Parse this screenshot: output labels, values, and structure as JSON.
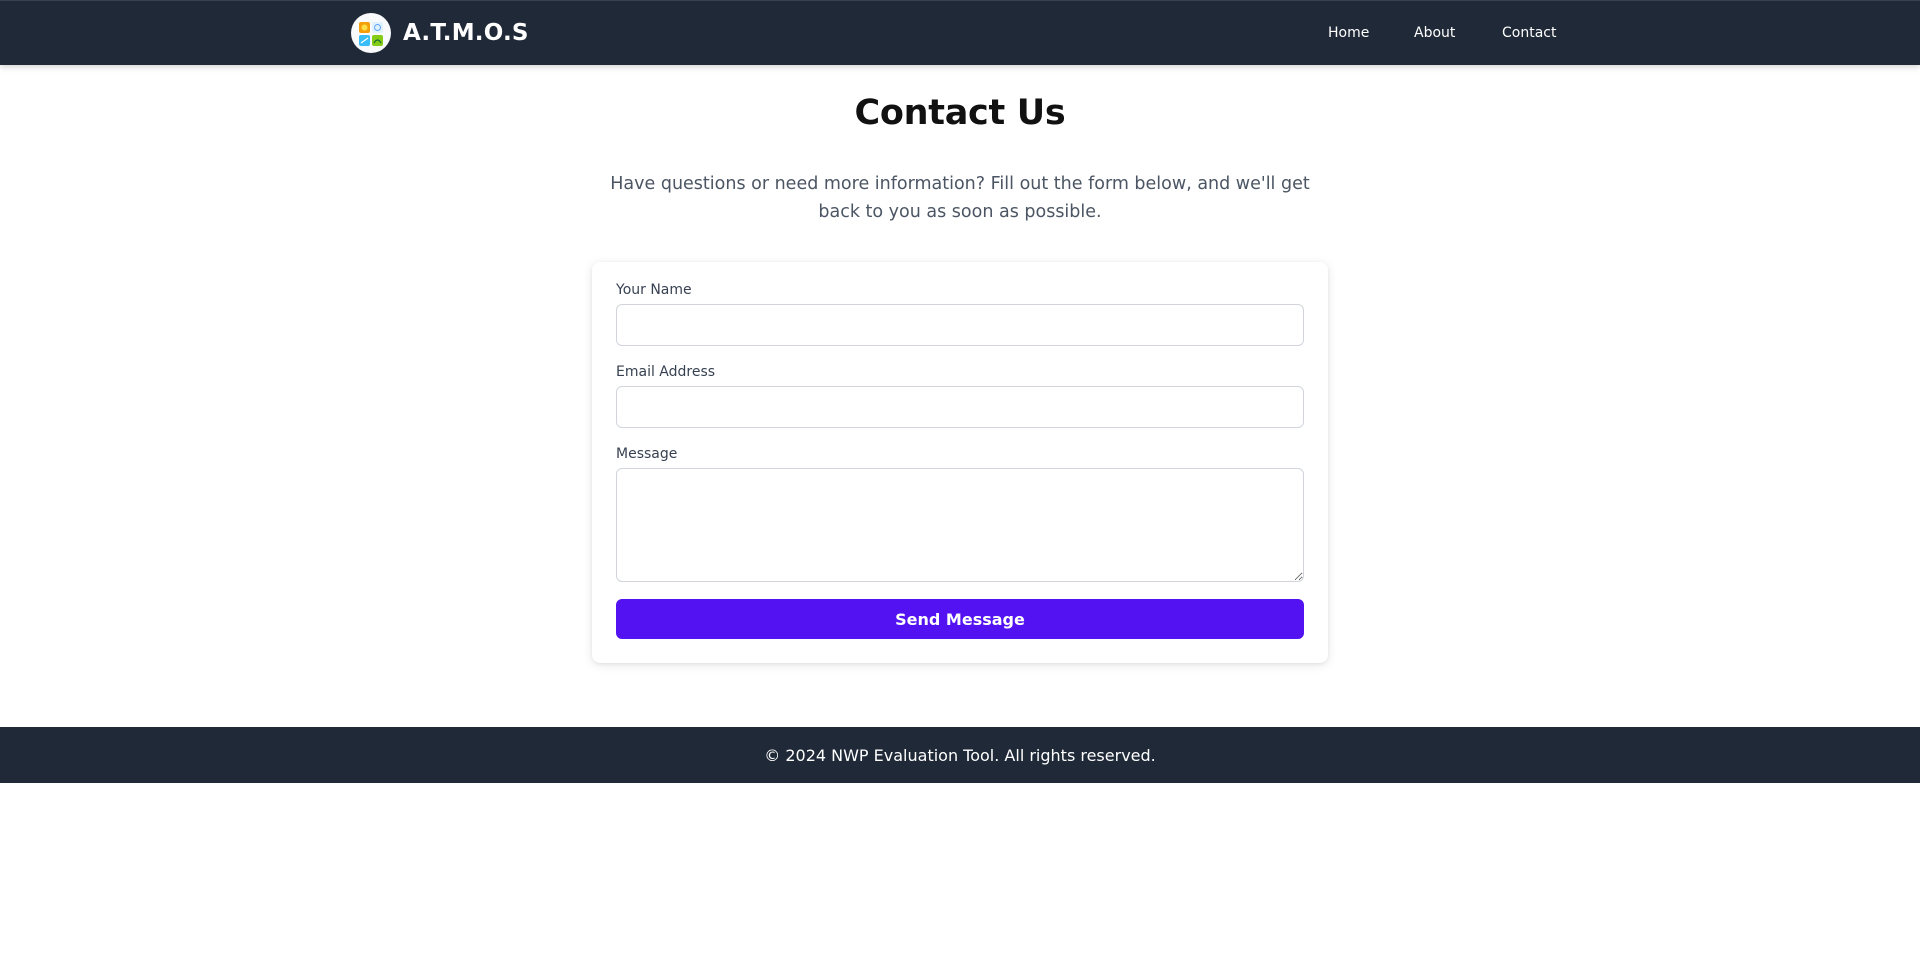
{
  "navbar": {
    "brand_name": "A.T.M.O.S",
    "logo_icon": "weather-quadrant-logo",
    "links": {
      "home": "Home",
      "about": "About",
      "contact": "Contact"
    }
  },
  "main": {
    "title": "Contact Us",
    "intro": "Have questions or need more information? Fill out the form below, and we'll get back to you as soon as possible."
  },
  "form": {
    "name_label": "Your Name",
    "name_value": "",
    "email_label": "Email Address",
    "email_value": "",
    "message_label": "Message",
    "message_value": "",
    "submit_label": "Send Message"
  },
  "footer": {
    "text": "© 2024 NWP Evaluation Tool. All rights reserved."
  },
  "colors": {
    "navbar_bg": "#1f2937",
    "accent": "#5212f2",
    "footer_bg": "#1f2937",
    "intro_text": "#4b5563"
  }
}
